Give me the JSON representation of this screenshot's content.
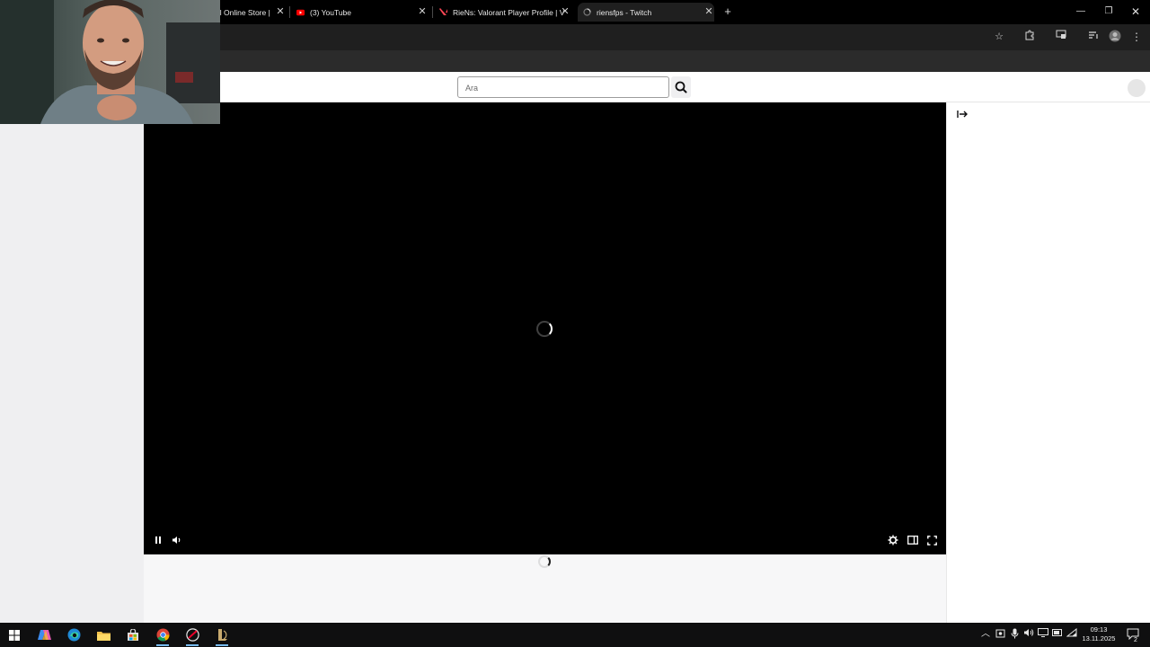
{
  "browser": {
    "tabs": [
      {
        "title": "al Online Store |",
        "icon": "store-icon"
      },
      {
        "title": "(3) YouTube",
        "icon": "youtube-icon"
      },
      {
        "title": "RieNs: Valorant Player Profile | V",
        "icon": "valorant-icon"
      },
      {
        "title": "riensfps - Twitch",
        "icon": "twitch-loading-icon",
        "active": true
      }
    ],
    "new_tab_label": "+",
    "colors": {
      "tabstrip": "#000000",
      "toolbar": "#1f1f1f",
      "bookmarks_bar": "#2b2b2b"
    }
  },
  "site": {
    "search": {
      "placeholder": "Ara"
    },
    "colors": {
      "player_bg": "#000000",
      "sidebar_bg": "#efeff1",
      "chat_bg": "#ffffff"
    }
  },
  "taskbar": {
    "clock": {
      "time": "09:13",
      "date": "13.11.2025"
    },
    "notification_count": "2",
    "pinned": [
      "windows-start-icon",
      "copilot-icon",
      "edge-icon",
      "file-explorer-icon",
      "store-icon",
      "chrome-icon",
      "riot-client-icon",
      "league-icon"
    ]
  }
}
